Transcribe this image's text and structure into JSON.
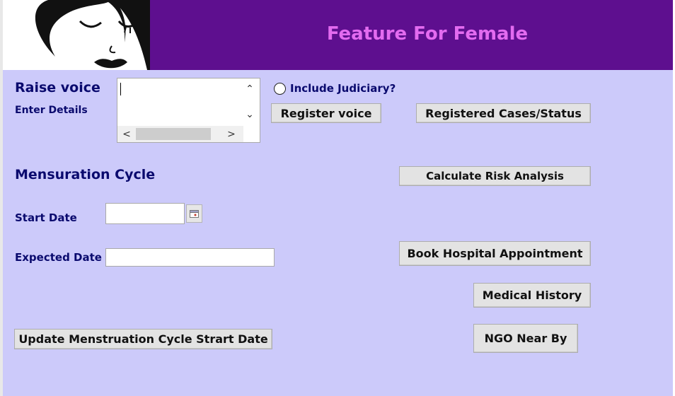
{
  "header": {
    "title": "Feature For Female"
  },
  "raise_voice": {
    "title": "Raise voice",
    "subtitle": "Enter Details",
    "textarea_value": "",
    "include_judiciary_label": "Include Judiciary?",
    "register_button": "Register voice",
    "cases_button": "Registered Cases/Status"
  },
  "cycle": {
    "title": "Mensuration Cycle",
    "start_date_label": "Start Date",
    "start_date_value": "",
    "expected_date_label": "Expected Date",
    "expected_date_value": "",
    "update_button": "Update Menstruation Cycle Strart Date"
  },
  "actions": {
    "risk_button": "Calculate Risk Analysis",
    "hospital_button": "Book Hospital Appointment",
    "history_button": "Medical History",
    "ngo_button": "NGO Near By"
  },
  "icons": {
    "logo": "woman-face-logo",
    "calendar": "calendar-icon"
  },
  "colors": {
    "header_bg": "#5e0f8f",
    "title": "#e36bf0",
    "panel_bg": "#cccafa",
    "label": "#0a0a6e"
  }
}
